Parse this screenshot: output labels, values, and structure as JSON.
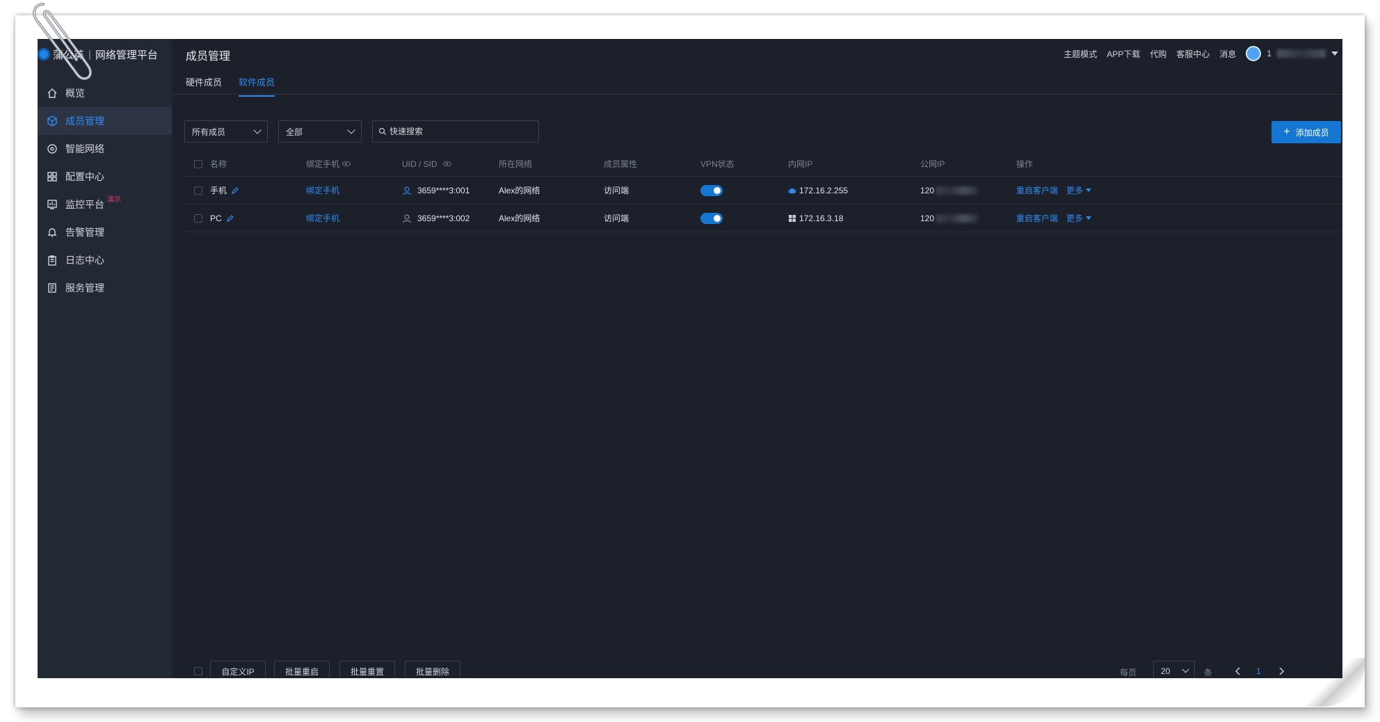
{
  "app": {
    "brand_name": "蒲公英",
    "brand_subtitle": "网络管理平台"
  },
  "sidebar": {
    "items": [
      {
        "label": "概览",
        "icon": "home-icon",
        "active": false
      },
      {
        "label": "成员管理",
        "icon": "cube-icon",
        "active": true
      },
      {
        "label": "智能网络",
        "icon": "network-icon",
        "active": false
      },
      {
        "label": "配置中心",
        "icon": "grid-icon",
        "active": false
      },
      {
        "label": "监控平台",
        "icon": "monitor-icon",
        "active": false,
        "badge": "演示"
      },
      {
        "label": "告警管理",
        "icon": "bell-icon",
        "active": false
      },
      {
        "label": "日志中心",
        "icon": "clipboard-icon",
        "active": false
      },
      {
        "label": "服务管理",
        "icon": "document-icon",
        "active": false
      }
    ]
  },
  "header": {
    "title": "成员管理",
    "links": [
      "主题模式",
      "APP下载",
      "代购",
      "客服中心",
      "消息"
    ],
    "user_prefix": "1"
  },
  "tabs": [
    {
      "label": "硬件成员",
      "active": false
    },
    {
      "label": "软件成员",
      "active": true
    }
  ],
  "filters": {
    "member_select": "所有成员",
    "status_select": "全部",
    "search_placeholder": "快速搜索"
  },
  "add_button": "添加成员",
  "table": {
    "columns": [
      "名称",
      "绑定手机",
      "UID / SID",
      "所在网络",
      "成员属性",
      "VPN状态",
      "内网IP",
      "公网IP",
      "操作"
    ],
    "rows": [
      {
        "name": "手机",
        "bind": "绑定手机",
        "uid": "3659****3:001",
        "network": "Alex的网络",
        "attr": "访问端",
        "vpn": true,
        "os": "android-icon",
        "lan_ip": "172.16.2.255",
        "wan_ip_prefix": "120",
        "action": "重启客户端",
        "more": "更多"
      },
      {
        "name": "PC",
        "bind": "绑定手机",
        "uid": "3659****3:002",
        "network": "Alex的网络",
        "attr": "访问端",
        "vpn": true,
        "os": "windows-icon",
        "lan_ip": "172.16.3.18",
        "wan_ip_prefix": "120",
        "action": "重启客户端",
        "more": "更多"
      }
    ]
  },
  "footer": {
    "buttons": [
      "自定义IP",
      "批量重启",
      "批量重置",
      "批量删除"
    ],
    "per_page_label": "每页",
    "per_page_value": "20",
    "per_page_unit": "条",
    "current_page": "1"
  },
  "colors": {
    "accent": "#1677d2",
    "link": "#2e8cf0",
    "background": "#1c202b",
    "sidebar": "#232835",
    "badge": "#e5405e"
  }
}
